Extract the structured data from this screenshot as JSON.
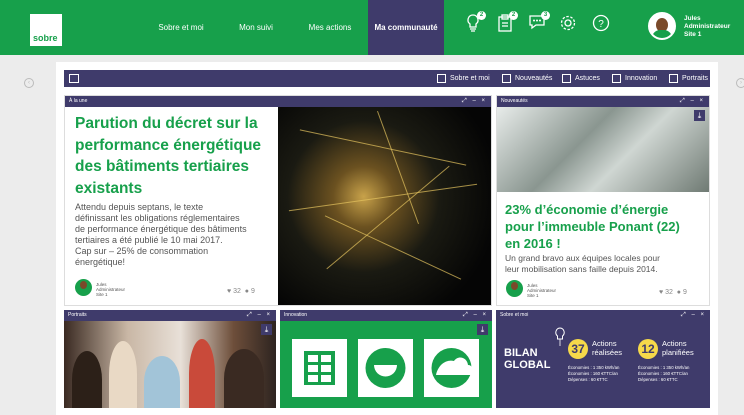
{
  "header": {
    "logo_text": "sobre",
    "nav": [
      "Sobre et moi",
      "Mon suivi",
      "Mes actions",
      "Ma communauté"
    ],
    "badges": [
      "2",
      "2",
      "3"
    ],
    "user_name": "Jules",
    "user_role": "Administrateur",
    "user_site": "Site 1"
  },
  "filters": [
    "Sobre et moi",
    "Nouveautés",
    "Astuces",
    "Innovation",
    "Portraits"
  ],
  "card_alaune": {
    "header": "À la une",
    "title_lines": [
      "Parution du décret sur la",
      "performance énergétique",
      "des bâtiments tertiaires",
      "existants"
    ],
    "body_lines": [
      "Attendu depuis septans, le texte",
      "définissant les obligations réglementaires",
      "de performance énergétique des bâtiments",
      "tertiaires  a été publié le 10 mai 2017.",
      "Cap sur – 25% de consommation",
      "énergétique!"
    ],
    "author": "Jules",
    "author_role": "Administrateur",
    "author_site": "Site 1",
    "likes": "32",
    "comments": "9"
  },
  "card_nouveautes": {
    "header": "Nouveautés",
    "title_lines": [
      "23% d’économie d’énergie",
      "pour l’immeuble Ponant (22)",
      "en 2016 !"
    ],
    "body_lines": [
      "Un grand bravo aux équipes locales pour",
      "leur mobilisation sans faille depuis 2014."
    ],
    "author": "Jules",
    "author_role": "Administrateur",
    "author_site": "Site 1",
    "likes": "32",
    "comments": "9"
  },
  "card_portraits": {
    "header": "Portraits"
  },
  "card_innovation": {
    "header": "Innovation"
  },
  "card_sobre": {
    "header": "Sobre et moi",
    "bilan_line1": "BILAN",
    "bilan_line2": "GLOBAL",
    "realisees_count": "37",
    "realisees_label1": "Actions",
    "realisees_label2": "réalisées",
    "planifiees_count": "12",
    "planifiees_label1": "Actions",
    "planifiees_label2": "planifiées",
    "left_stats": [
      "Économies : 1 350 kWh/an",
      "Économies : 160 €TTC/an",
      "Dépenses : 60 €TTC"
    ],
    "right_stats": [
      "Économies : 1 350 kWh/an",
      "Économies : 160 €TTC/an",
      "Dépenses : 60 €TTC"
    ]
  },
  "colors": {
    "green": "#17a04b",
    "purple": "#3f3b6b",
    "yellow": "#f6d94a"
  },
  "icons": [
    "bulb-icon",
    "clipboard-icon",
    "chat-icon",
    "gear-icon",
    "help-icon"
  ]
}
